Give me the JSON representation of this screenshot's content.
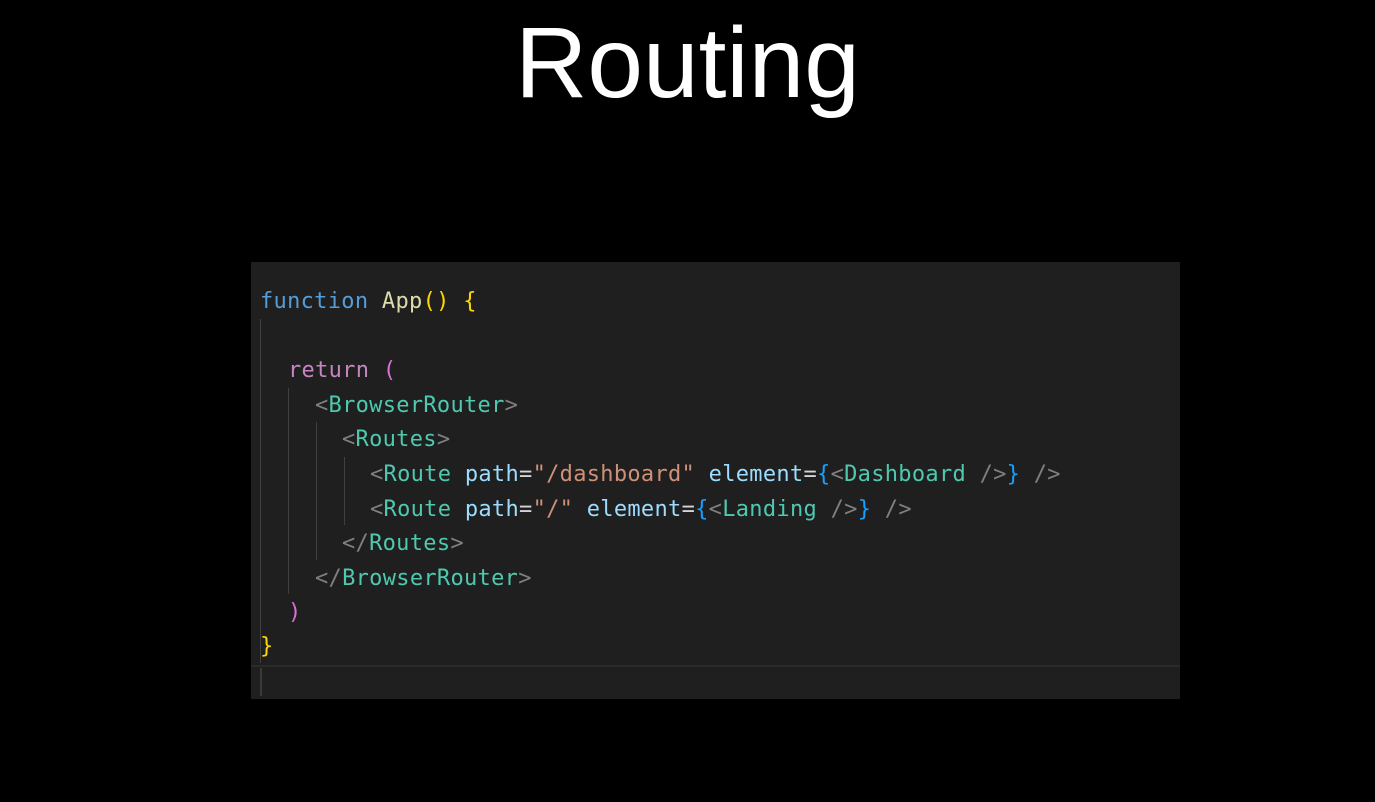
{
  "slide": {
    "title": "Routing"
  },
  "code": {
    "line1": {
      "kw": "function",
      "name": "App",
      "parens": "()",
      "brace": "{"
    },
    "line3": {
      "kw": "return",
      "paren": "("
    },
    "line4": {
      "open": "<",
      "tag": "BrowserRouter",
      "close": ">"
    },
    "line5": {
      "open": "<",
      "tag": "Routes",
      "close": ">"
    },
    "line6": {
      "open": "<",
      "tag": "Route",
      "attr1": "path",
      "eq1": "=",
      "val1": "\"/dashboard\"",
      "attr2": "element",
      "eq2": "=",
      "lbrace": "{",
      "inner_open": "<",
      "inner_tag": "Dashboard",
      "inner_close": " />",
      "rbrace": "}",
      "self_close": " />"
    },
    "line7": {
      "open": "<",
      "tag": "Route",
      "attr1": "path",
      "eq1": "=",
      "val1": "\"/\"",
      "attr2": "element",
      "eq2": "=",
      "lbrace": "{",
      "inner_open": "<",
      "inner_tag": "Landing",
      "inner_close": " />",
      "rbrace": "}",
      "self_close": " />"
    },
    "line8": {
      "open": "</",
      "tag": "Routes",
      "close": ">"
    },
    "line9": {
      "open": "</",
      "tag": "BrowserRouter",
      "close": ">"
    },
    "line10": {
      "paren": ")"
    },
    "line11": {
      "brace": "}"
    }
  },
  "colors": {
    "background": "#000000",
    "editor_background": "#1f1f1f",
    "keyword": "#569cd6",
    "function_name": "#dcdcaa",
    "control_keyword": "#c586c0",
    "tag": "#4ec9b0",
    "attribute": "#9cdcfe",
    "string": "#ce9178",
    "bracket_gold": "#ffd700",
    "bracket_purple": "#da70d6",
    "bracket_blue": "#179fff"
  }
}
